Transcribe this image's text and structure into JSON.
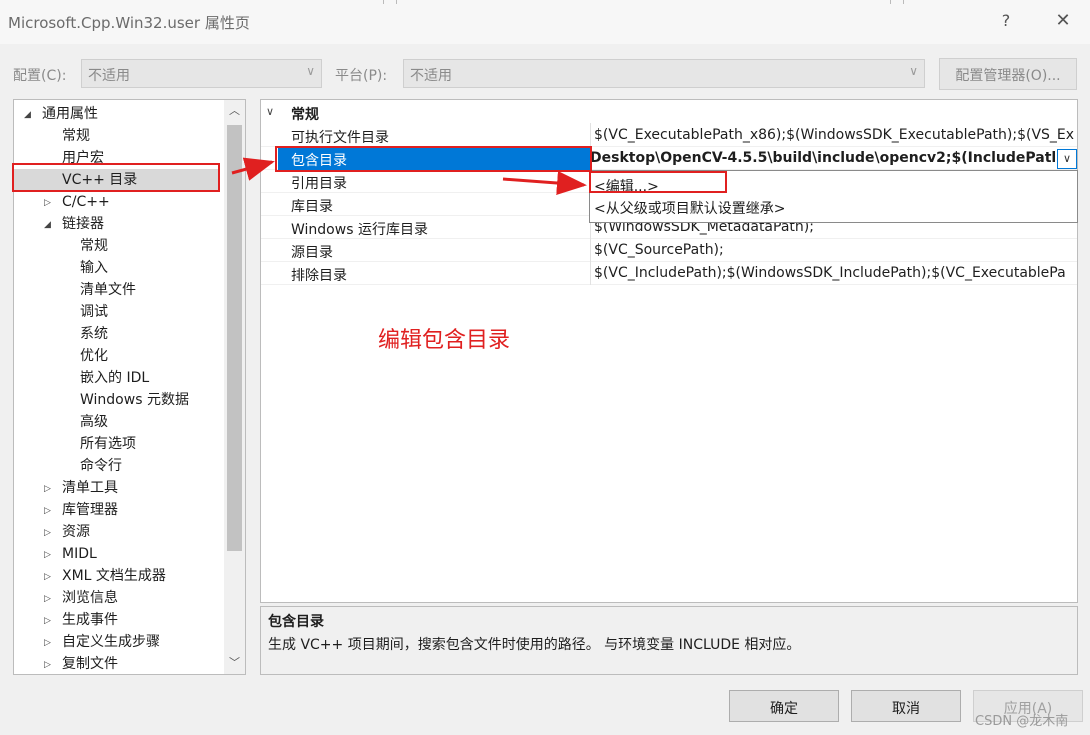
{
  "window": {
    "title": "Microsoft.Cpp.Win32.user 属性页",
    "help": "?",
    "close": "✕"
  },
  "config_row": {
    "config_label": "配置(C):",
    "config_value": "不适用",
    "platform_label": "平台(P):",
    "platform_value": "不适用",
    "manager_button": "配置管理器(O)..."
  },
  "tree": {
    "items": [
      {
        "label": "通用属性",
        "arrow": "◢"
      },
      {
        "label": "常规"
      },
      {
        "label": "用户宏"
      },
      {
        "label": "VC++ 目录"
      },
      {
        "label": "C/C++",
        "arrow": "▷"
      },
      {
        "label": "链接器",
        "arrow": "◢"
      },
      {
        "label": "常规"
      },
      {
        "label": "输入"
      },
      {
        "label": "清单文件"
      },
      {
        "label": "调试"
      },
      {
        "label": "系统"
      },
      {
        "label": "优化"
      },
      {
        "label": "嵌入的 IDL"
      },
      {
        "label": "Windows 元数据"
      },
      {
        "label": "高级"
      },
      {
        "label": "所有选项"
      },
      {
        "label": "命令行"
      },
      {
        "label": "清单工具",
        "arrow": "▷"
      },
      {
        "label": "库管理器",
        "arrow": "▷"
      },
      {
        "label": "资源",
        "arrow": "▷"
      },
      {
        "label": "MIDL",
        "arrow": "▷"
      },
      {
        "label": "XML 文档生成器",
        "arrow": "▷"
      },
      {
        "label": "浏览信息",
        "arrow": "▷"
      },
      {
        "label": "生成事件",
        "arrow": "▷"
      },
      {
        "label": "自定义生成步骤",
        "arrow": "▷"
      },
      {
        "label": "复制文件",
        "arrow": "▷"
      }
    ],
    "selected_index": 3
  },
  "grid": {
    "category": "常规",
    "category_arrow": "∨",
    "rows": [
      {
        "name": "可执行文件目录",
        "value": "$(VC_ExecutablePath_x86);$(WindowsSDK_ExecutablePath);$(VS_Ex"
      },
      {
        "name": "包含目录",
        "value": "Desktop\\OpenCV-4.5.5\\build\\include\\opencv2;$(IncludePath)"
      },
      {
        "name": "引用目录",
        "value": ""
      },
      {
        "name": "库目录",
        "value": ""
      },
      {
        "name": "Windows 运行库目录",
        "value": "$(WindowsSDK_MetadataPath);"
      },
      {
        "name": "源目录",
        "value": "$(VC_SourcePath);"
      },
      {
        "name": "排除目录",
        "value": "$(VC_IncludePath);$(WindowsSDK_IncludePath);$(VC_ExecutablePa"
      }
    ],
    "selected_row": 1,
    "dropdown_items": [
      "<编辑...>",
      "<从父级或项目默认设置继承>"
    ]
  },
  "description": {
    "title": "包含目录",
    "text": "生成 VC++ 项目期间，搜索包含文件时使用的路径。 与环境变量 INCLUDE 相对应。"
  },
  "buttons": {
    "ok": "确定",
    "cancel": "取消",
    "apply": "应用(A)"
  },
  "annotation": {
    "text": "编辑包含目录",
    "watermark": "CSDN @龙木南"
  },
  "colors": {
    "selection": "#0078d7",
    "annotation": "#e02020"
  }
}
